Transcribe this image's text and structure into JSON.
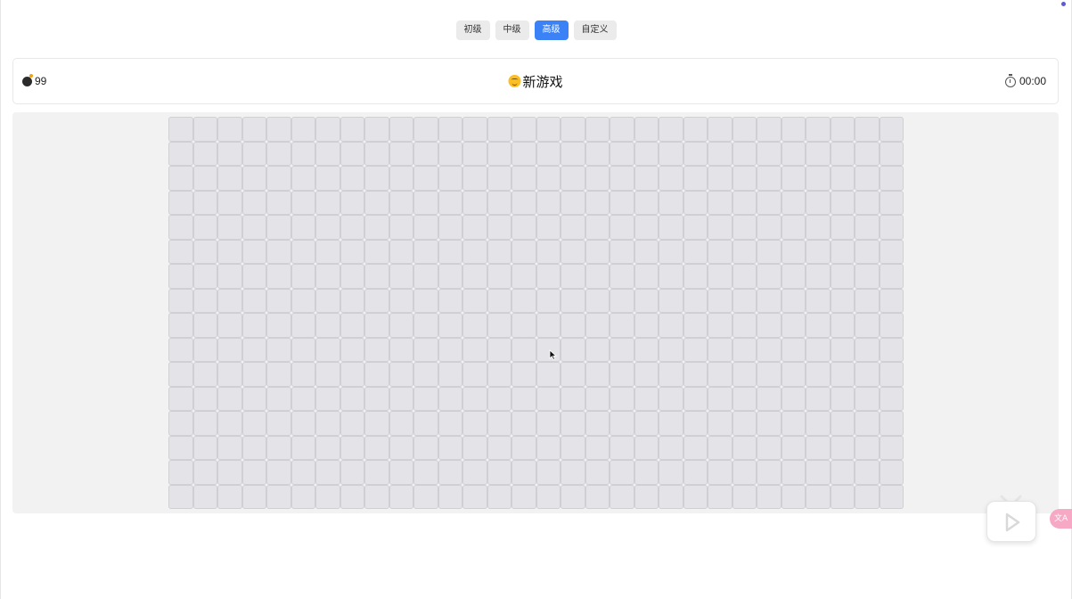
{
  "difficulty": {
    "buttons": [
      {
        "label": "初级",
        "active": false
      },
      {
        "label": "中级",
        "active": false
      },
      {
        "label": "高级",
        "active": true
      },
      {
        "label": "自定义",
        "active": false
      }
    ]
  },
  "status": {
    "mine_icon": "bomb-icon",
    "mines_remaining": "99",
    "new_game_icon": "smiley-icon",
    "new_game_label": "新游戏",
    "timer_icon": "stopwatch-icon",
    "time": "00:00"
  },
  "board": {
    "rows": 16,
    "cols": 30,
    "cell_state": "unrevealed"
  },
  "widgets": {
    "player_icon": "play-icon",
    "translate_label": "文A"
  },
  "colors": {
    "accent": "#3b82f6",
    "cell": "#e4e3e8",
    "board_bg": "#f2f2f2"
  }
}
